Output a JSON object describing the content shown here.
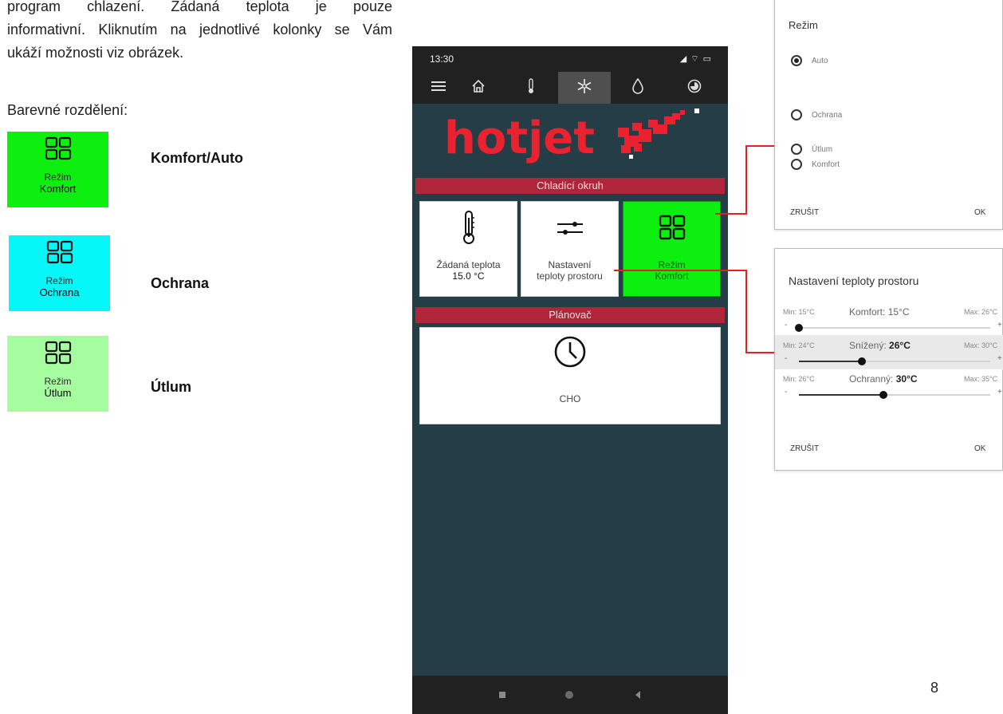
{
  "intro": {
    "line1": "program chlazení. Žádaná teplota je pouze",
    "line2": "informativní. Kliknutím na jednotlivé kolonky se Vám",
    "line3": "ukáží možnosti viz obrázek."
  },
  "colors_heading": "Barevné rozdělení:",
  "legend": [
    {
      "mode_label": "Režim",
      "mode_value": "Komfort",
      "description": "Komfort/Auto",
      "color": "#0df00f"
    },
    {
      "mode_label": "Režim",
      "mode_value": "Ochrana",
      "description": "Ochrana",
      "color": "#05f7f7"
    },
    {
      "mode_label": "Režim",
      "mode_value": "Útlum",
      "description": "Útlum",
      "color": "#a5fda0"
    }
  ],
  "phone": {
    "time": "13:30",
    "status_icons": "◢ ⌔ ▭",
    "section_cooling": "Chladící okruh",
    "tiles": [
      {
        "label": "Žádaná teplota",
        "value": "15.0 °C"
      },
      {
        "label": "Nastavení",
        "value": "teploty prostoru"
      },
      {
        "label": "Režim",
        "value": "Komfort"
      }
    ],
    "section_planner": "Plánovač",
    "planner_label": "CHO",
    "brand_color": "#e8222e"
  },
  "mode_dialog": {
    "title": "Režim",
    "options": [
      "Auto",
      "Ochrana",
      "Útlum",
      "Komfort"
    ],
    "selected": "Auto",
    "cancel": "ZRUŠIT",
    "ok": "OK"
  },
  "temp_dialog": {
    "title": "Nastavení teploty prostoru",
    "rows": [
      {
        "min": "Min: 15°C",
        "name": "Komfort:",
        "value": "15°C",
        "max": "Max: 26°C",
        "fraction": 0.0
      },
      {
        "min": "Min: 24°C",
        "name": "Snížený:",
        "value": "26°C",
        "max": "Max: 30°C",
        "fraction": 0.33
      },
      {
        "min": "Min: 26°C",
        "name": "Ochranný:",
        "value": "30°C",
        "max": "Max: 35°C",
        "fraction": 0.44
      }
    ],
    "minus": "-",
    "plus": "+",
    "cancel": "ZRUŠIT",
    "ok": "OK"
  },
  "page_number": "8"
}
